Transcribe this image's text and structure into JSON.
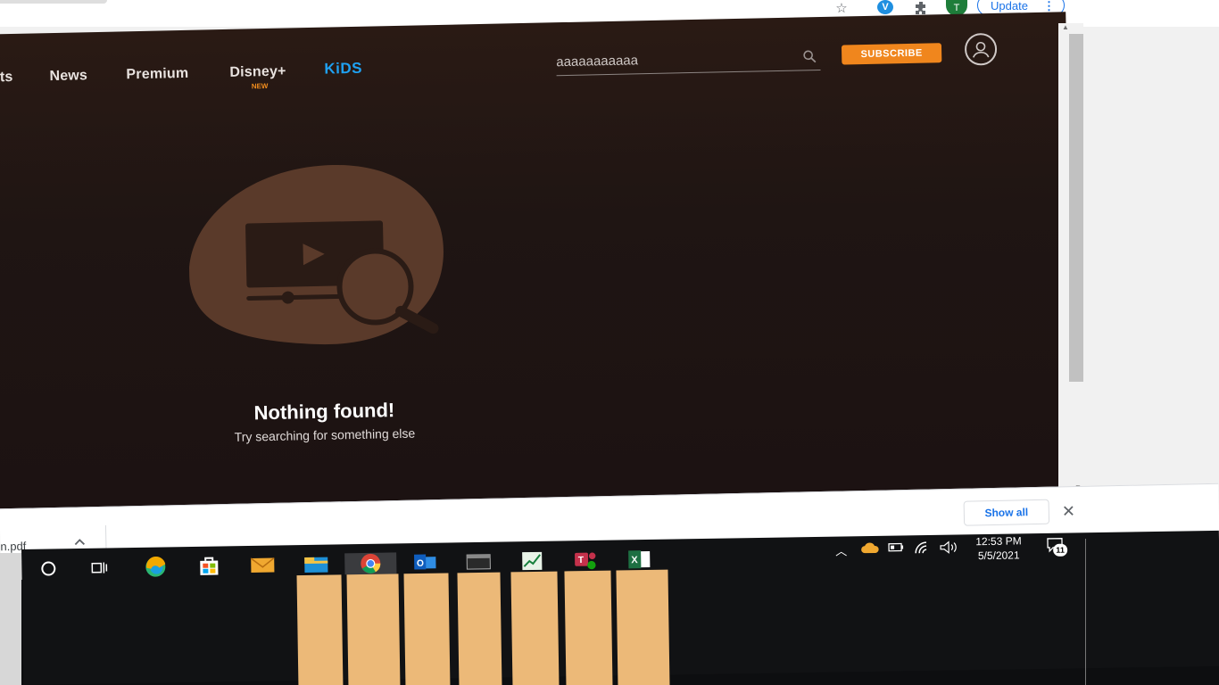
{
  "browser": {
    "update_label": "Update",
    "avatar_letter": "T",
    "extension_letter": "V"
  },
  "nav": {
    "items": [
      "orts",
      "News",
      "Premium",
      "Disney+",
      "KiDS"
    ],
    "disney_badge": "NEW"
  },
  "search": {
    "value": "aaaaaaaaaaa"
  },
  "subscribe_label": "SUBSCRIBE",
  "empty_state": {
    "title": "Nothing found!",
    "subtitle": "Try searching for something else"
  },
  "download_bar": {
    "file_name": "n.pdf",
    "show_all": "Show all"
  },
  "taskbar": {
    "time": "12:53 PM",
    "date": "5/5/2021",
    "notification_count": "11"
  },
  "colors": {
    "accent_orange": "#f0861d",
    "kids_blue": "#1fa1f2",
    "page_bg": "#1f1513",
    "blob": "#5a3a2a"
  }
}
